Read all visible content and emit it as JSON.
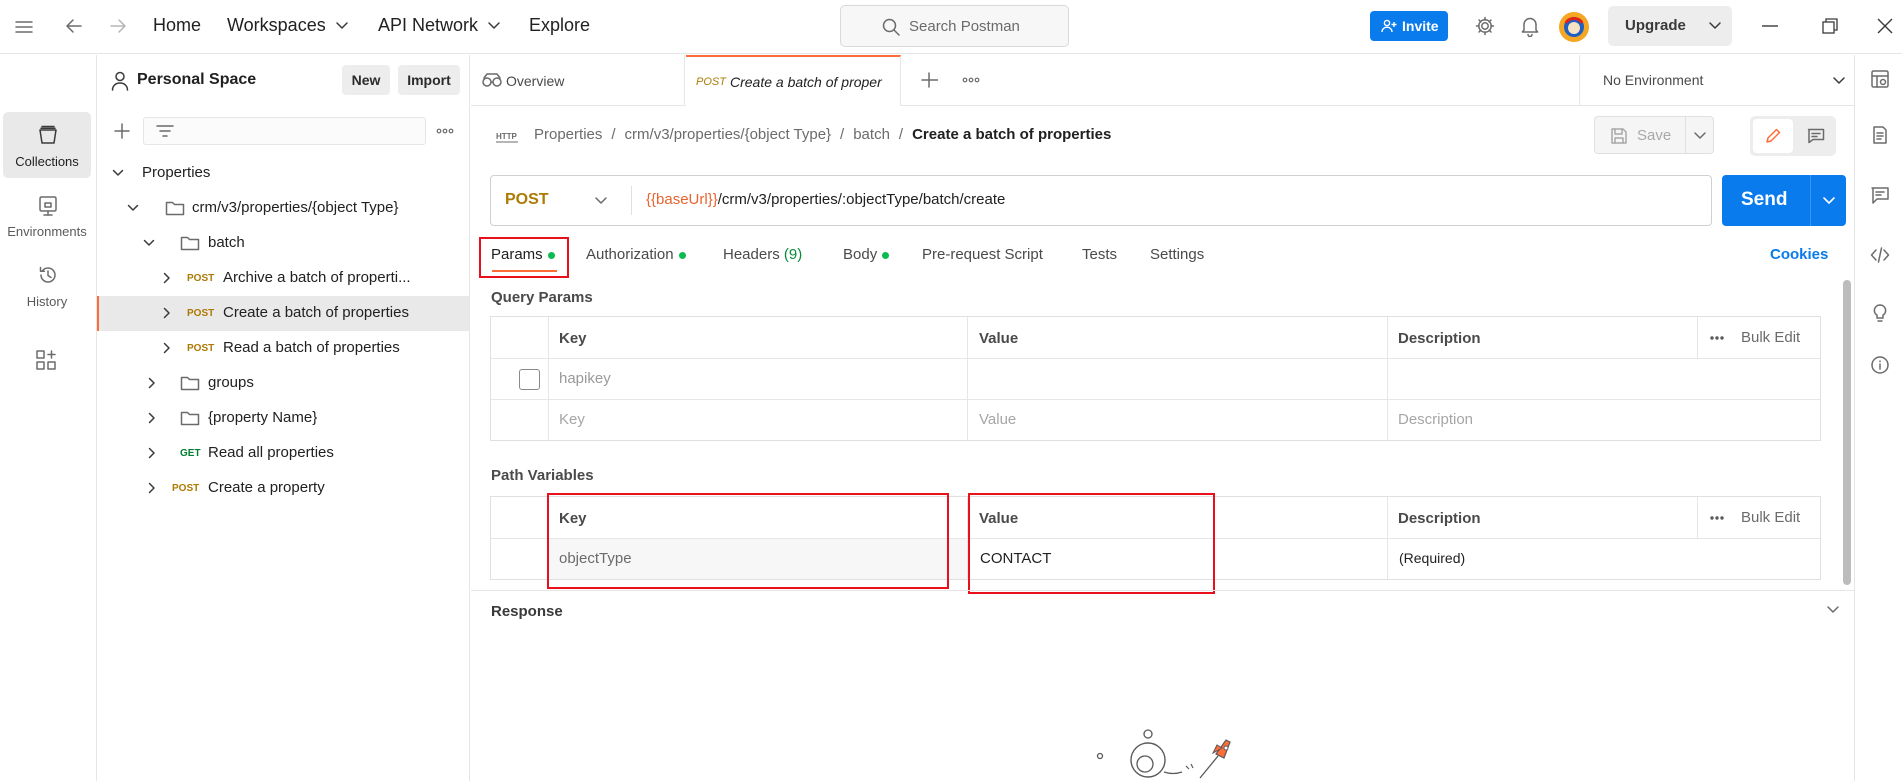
{
  "topbar": {
    "home": "Home",
    "workspaces": "Workspaces",
    "api_network": "API Network",
    "explore": "Explore",
    "search_placeholder": "Search Postman",
    "invite": "Invite",
    "upgrade": "Upgrade"
  },
  "rail": {
    "collections": "Collections",
    "environments": "Environments",
    "history": "History"
  },
  "sidebar": {
    "title": "Personal Space",
    "new_label": "New",
    "import_label": "Import",
    "tree": [
      {
        "label": "Properties"
      },
      {
        "label": "crm/v3/properties/{object Type}"
      },
      {
        "label": "batch"
      },
      {
        "method": "POST",
        "label": "Archive a batch of properti..."
      },
      {
        "method": "POST",
        "label": "Create a batch of properties"
      },
      {
        "method": "POST",
        "label": "Read a batch of properties"
      },
      {
        "label": "groups"
      },
      {
        "label": "{property Name}"
      },
      {
        "method": "GET",
        "label": "Read all properties"
      },
      {
        "method": "POST",
        "label": "Create a property"
      }
    ]
  },
  "tabs": {
    "overview": "Overview",
    "active_method": "POST",
    "active_title": "Create a batch of proper",
    "environment": "No Environment"
  },
  "request": {
    "crumbs": [
      "Properties",
      "crm/v3/properties/{object Type}",
      "batch"
    ],
    "crumb_current": "Create a batch of properties",
    "save": "Save",
    "method": "POST",
    "url_var": "{{baseUrl}}",
    "url_path": "/crm/v3/properties/:objectType/batch/create",
    "send": "Send"
  },
  "req_tabs": {
    "params": "Params",
    "authorization": "Authorization",
    "headers": "Headers",
    "headers_count": "(9)",
    "body": "Body",
    "prerequest": "Pre-request Script",
    "tests": "Tests",
    "settings": "Settings",
    "cookies": "Cookies"
  },
  "query_params": {
    "title": "Query Params",
    "headers": {
      "key": "Key",
      "value": "Value",
      "description": "Description",
      "bulk": "Bulk Edit"
    },
    "row1_key": "hapikey",
    "placeholders": {
      "key": "Key",
      "value": "Value",
      "description": "Description"
    }
  },
  "path_vars": {
    "title": "Path Variables",
    "headers": {
      "key": "Key",
      "value": "Value",
      "description": "Description",
      "bulk": "Bulk Edit"
    },
    "row_key": "objectType",
    "row_value": "CONTACT",
    "row_description": "(Required)"
  },
  "response": {
    "title": "Response"
  },
  "colors": {
    "accent_orange": "#ff6c37",
    "primary_blue": "#097bed",
    "post_method": "#ad7a03",
    "get_method": "#007f31",
    "highlight_red": "#e8101a"
  }
}
